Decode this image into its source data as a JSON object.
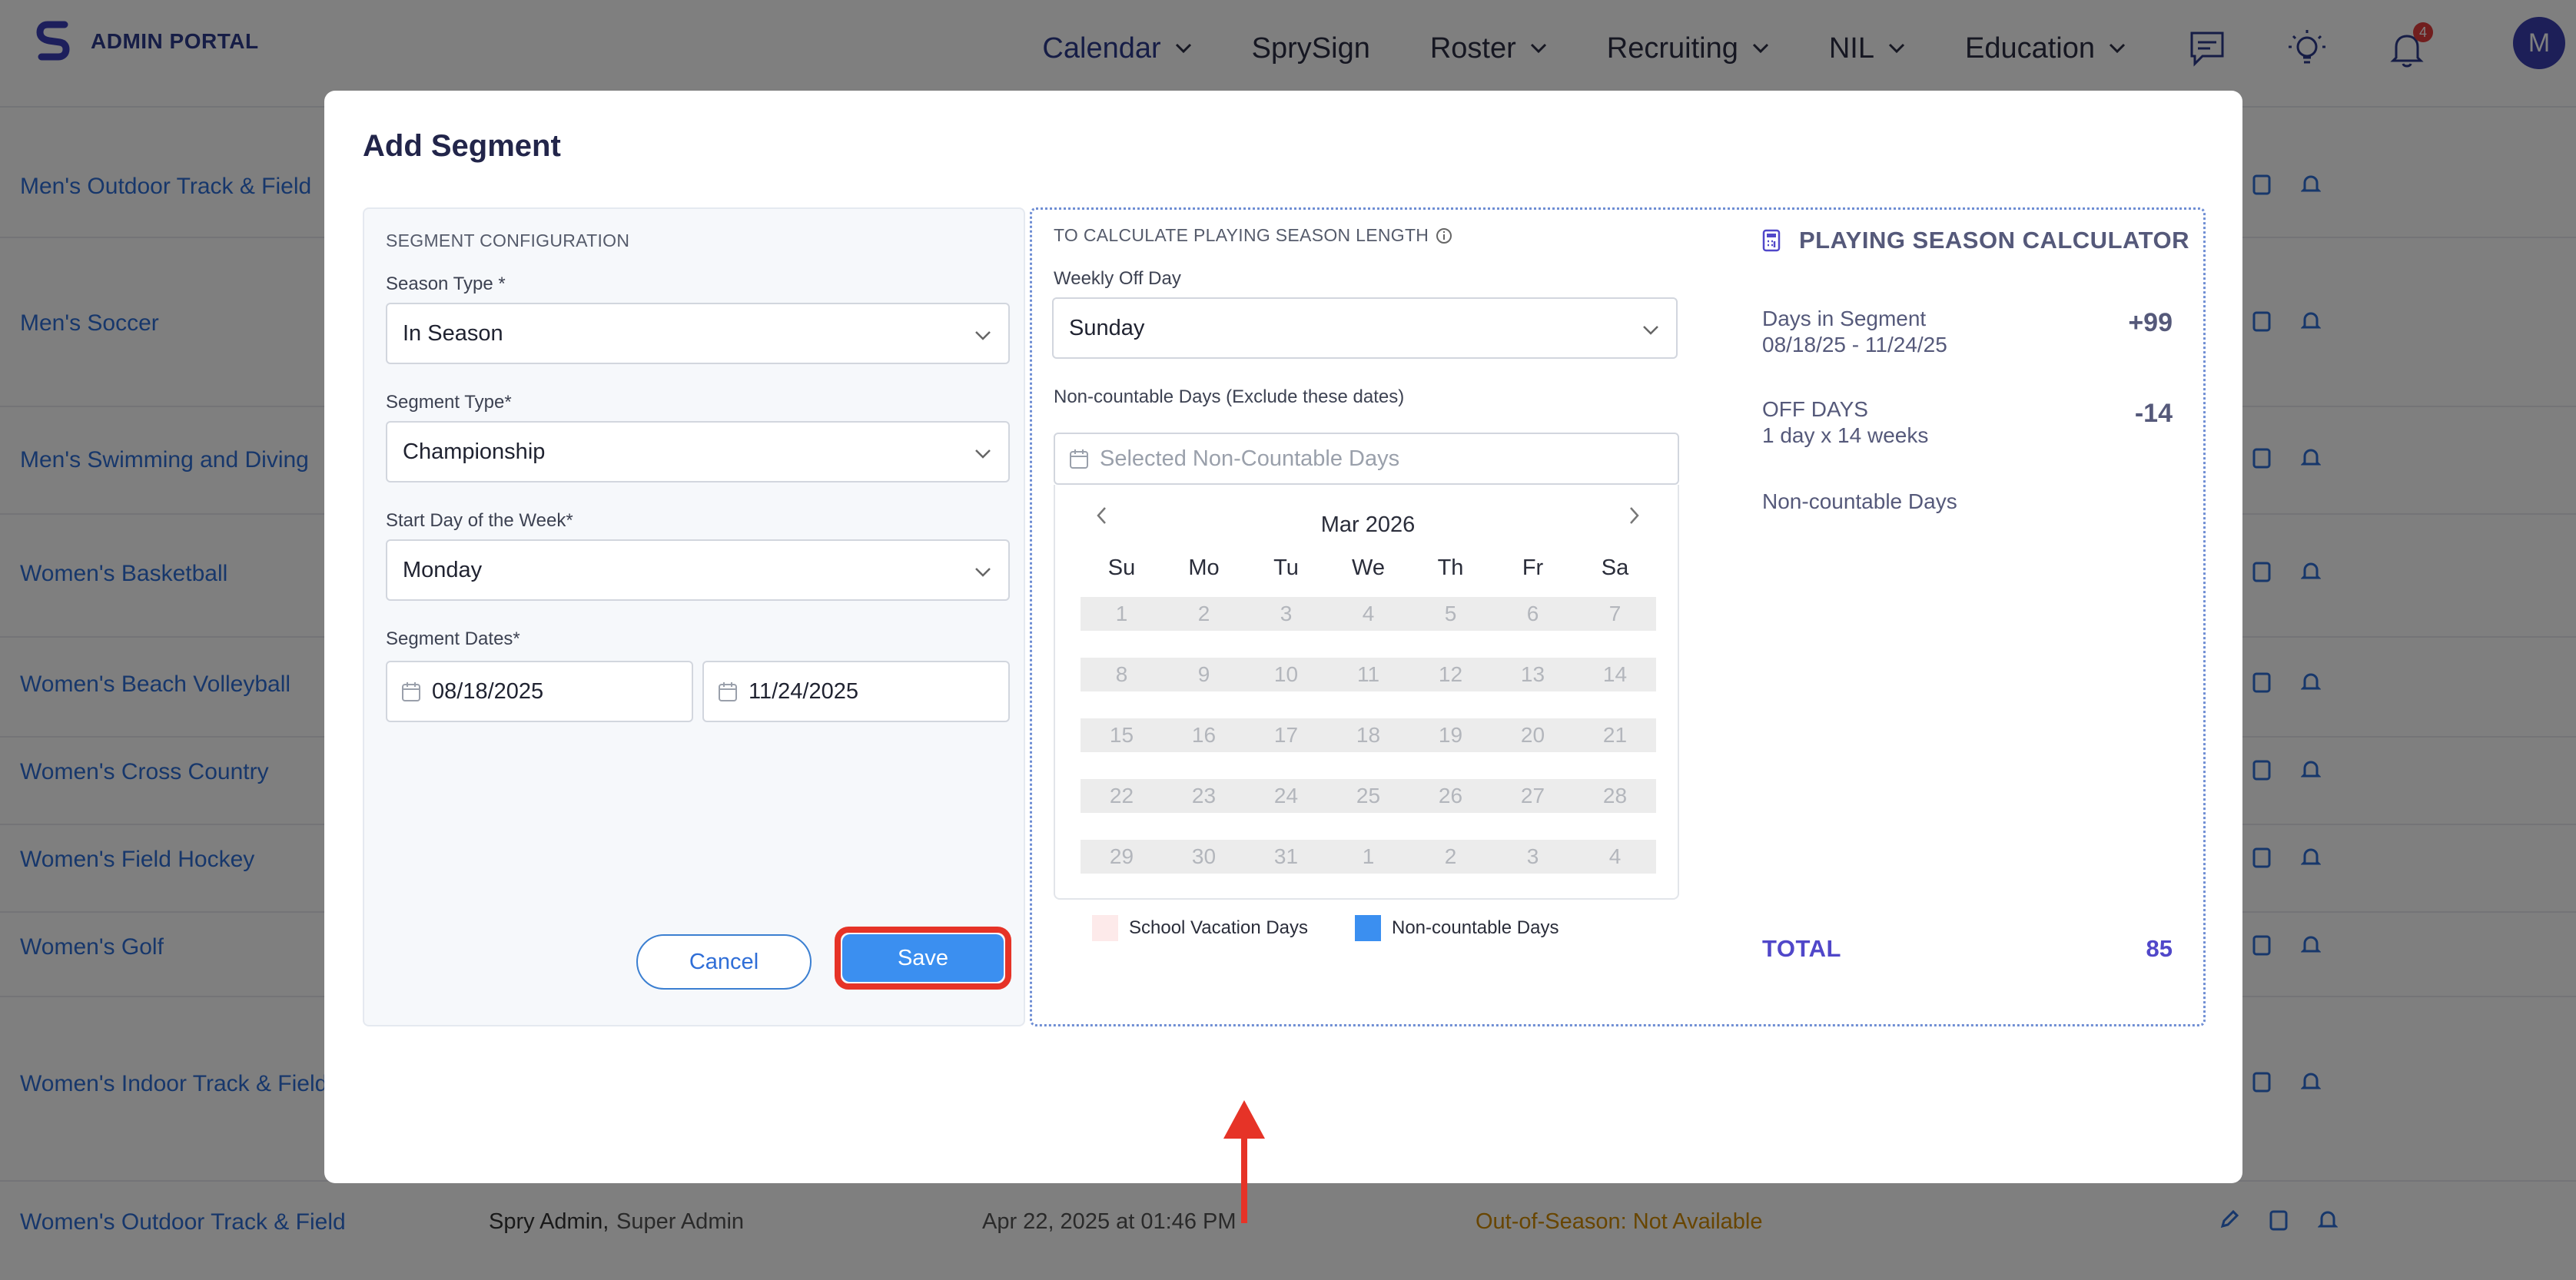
{
  "brand": {
    "name": "ADMIN PORTAL"
  },
  "nav": {
    "items": [
      {
        "label": "Calendar",
        "dropdown": true,
        "active": true
      },
      {
        "label": "SprySign",
        "dropdown": false,
        "active": false
      },
      {
        "label": "Roster",
        "dropdown": true,
        "active": false
      },
      {
        "label": "Recruiting",
        "dropdown": true,
        "active": false
      },
      {
        "label": "NIL",
        "dropdown": true,
        "active": false
      },
      {
        "label": "Education",
        "dropdown": true,
        "active": false
      }
    ],
    "notification_count": "4",
    "avatar_initial": "M"
  },
  "background_rows": [
    {
      "team": "Men's Outdoor Track & Field"
    },
    {
      "team": "Men's Soccer"
    },
    {
      "team": "Men's Swimming and Diving"
    },
    {
      "team": "Women's Basketball"
    },
    {
      "team": "Women's Beach Volleyball"
    },
    {
      "team": "Women's Cross Country"
    },
    {
      "team": "Women's Field Hockey"
    },
    {
      "team": "Women's Golf"
    },
    {
      "team": "Women's Indoor Track & Field"
    },
    {
      "team": "Women's Outdoor Track & Field",
      "user": "Spry Admin,",
      "role": "Super Admin",
      "date": "Apr 22, 2025 at 01:46 PM",
      "status": "Out-of-Season: Not Available"
    }
  ],
  "modal": {
    "title": "Add Segment",
    "config": {
      "heading": "SEGMENT CONFIGURATION",
      "season_type_label": "Season Type *",
      "season_type_value": "In Season",
      "segment_type_label": "Segment Type*",
      "segment_type_value": "Championship",
      "start_day_label": "Start Day of the Week*",
      "start_day_value": "Monday",
      "dates_label": "Segment Dates*",
      "start_date": "08/18/2025",
      "end_date": "11/24/2025",
      "cancel_label": "Cancel",
      "save_label": "Save"
    },
    "calc": {
      "heading": "TO CALCULATE PLAYING SEASON LENGTH",
      "weekly_off_label": "Weekly Off Day",
      "weekly_off_value": "Sunday",
      "noncount_label": "Non-countable Days (Exclude these dates)",
      "noncount_placeholder": "Selected Non-Countable Days",
      "calendar": {
        "month": "Mar 2026",
        "dow": [
          "Su",
          "Mo",
          "Tu",
          "We",
          "Th",
          "Fr",
          "Sa"
        ],
        "weeks": [
          [
            "1",
            "2",
            "3",
            "4",
            "5",
            "6",
            "7"
          ],
          [
            "8",
            "9",
            "10",
            "11",
            "12",
            "13",
            "14"
          ],
          [
            "15",
            "16",
            "17",
            "18",
            "19",
            "20",
            "21"
          ],
          [
            "22",
            "23",
            "24",
            "25",
            "26",
            "27",
            "28"
          ],
          [
            "29",
            "30",
            "31",
            "1",
            "2",
            "3",
            "4"
          ]
        ]
      },
      "legend": [
        {
          "label": "School Vacation Days",
          "color": "#fdeaea"
        },
        {
          "label": "Non-countable Days",
          "color": "#3b8ff0"
        }
      ]
    },
    "calculator": {
      "title": "PLAYING SEASON CALCULATOR",
      "days_label": "Days in Segment",
      "days_range": "08/18/25 - 11/24/25",
      "days_value": "+99",
      "off_label": "OFF DAYS",
      "off_detail": "1 day x 14 weeks",
      "off_value": "-14",
      "noncount_label": "Non-countable Days",
      "total_label": "TOTAL",
      "total_value": "85"
    }
  },
  "colors": {
    "accent": "#3b8ff0",
    "link": "#2f6ed7",
    "annotation": "#e63327",
    "total": "#5047c9"
  }
}
